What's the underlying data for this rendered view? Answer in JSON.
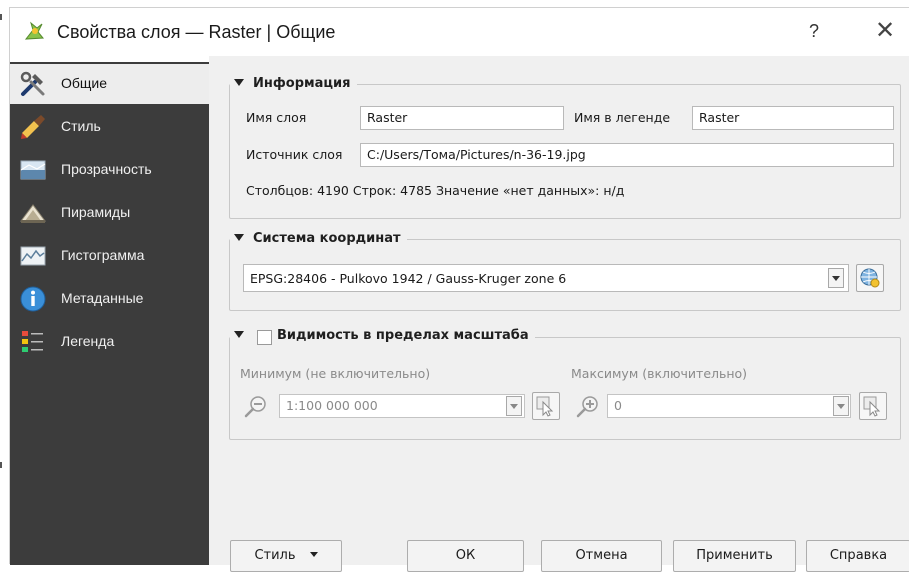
{
  "window": {
    "title": "Свойства слоя — Raster | Общие",
    "help": "?",
    "close": "✕"
  },
  "sidebar": {
    "items": [
      {
        "label": "Общие",
        "icon": "tools-icon",
        "active": true
      },
      {
        "label": "Стиль",
        "icon": "paint-brush-icon"
      },
      {
        "label": "Прозрачность",
        "icon": "transparency-icon"
      },
      {
        "label": "Пирамиды",
        "icon": "pyramids-icon"
      },
      {
        "label": "Гистограмма",
        "icon": "histogram-icon"
      },
      {
        "label": "Метаданные",
        "icon": "info-icon"
      },
      {
        "label": "Легенда",
        "icon": "legend-icon"
      }
    ]
  },
  "info": {
    "title": "Информация",
    "layer_name_label": "Имя слоя",
    "layer_name_value": "Raster",
    "legend_name_label": "Имя в легенде",
    "legend_name_value": "Raster",
    "source_label": "Источник слоя",
    "source_value": "C:/Users/Тома/Pictures/n-36-19.jpg",
    "stats": "Столбцов: 4190 Строк: 4785 Значение «нет данных»: н/д"
  },
  "crs": {
    "title": "Система координат",
    "value": "EPSG:28406 - Pulkovo 1942 / Gauss-Kruger zone 6"
  },
  "scale": {
    "title": "Видимость в пределах масштаба",
    "checked": false,
    "min_label": "Минимум (не включительно)",
    "min_value": "1:100 000 000",
    "max_label": "Максимум (включительно)",
    "max_value": "0"
  },
  "buttons": {
    "style": "Стиль",
    "ok": "ОК",
    "cancel": "Отмена",
    "apply": "Применить",
    "help": "Справка"
  }
}
